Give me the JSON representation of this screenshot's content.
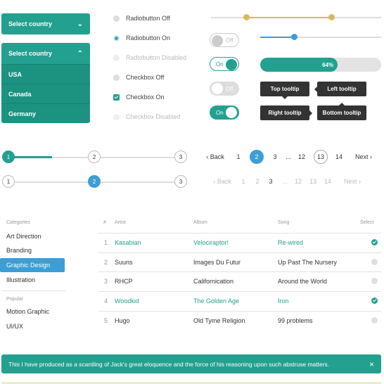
{
  "select_closed": {
    "label": "Select country"
  },
  "select_open": {
    "label": "Select country",
    "options": [
      "USA",
      "Canada",
      "Germany"
    ]
  },
  "options": {
    "radio_off": "Radiobutton Off",
    "radio_on": "Radiobutton On",
    "radio_disabled": "Radiobutton Disabled",
    "check_off": "Checkbox Off",
    "check_on": "Checkbox On",
    "check_disabled": "Checkbox Disabled"
  },
  "toggles": {
    "off_label": "Off",
    "on_label": "On"
  },
  "sliders": {
    "range_low": 0.21,
    "range_high": 0.71,
    "single": 0.28
  },
  "progress": {
    "value": 0.64,
    "label": "64%"
  },
  "tooltips": {
    "top": "Top tooltip",
    "left": "Left tooltip",
    "right": "Right tooltip",
    "bottom": "Bottom tooltip"
  },
  "steppers": [
    {
      "steps": [
        "1",
        "2",
        "3"
      ],
      "active": 0
    },
    {
      "steps": [
        "1",
        "2",
        "3"
      ],
      "active": 1
    }
  ],
  "pagination_active": {
    "back": "‹ Back",
    "next": "Next ›",
    "pages": [
      "1",
      "2",
      "3",
      "...",
      "12",
      "13",
      "14"
    ],
    "current": "2",
    "outlined": "13"
  },
  "pagination_disabled": {
    "back": "‹ Back",
    "next": "Next ›",
    "pages": [
      "1",
      "2",
      "3",
      "...",
      "12",
      "13",
      "14"
    ],
    "current": "3"
  },
  "sidebar": {
    "categories_header": "Categories",
    "categories": [
      "Art Direction",
      "Branding",
      "Graphic Design",
      "Illustration"
    ],
    "selected": "Graphic Design",
    "popular_header": "Popular",
    "popular": [
      "Motion Graphic",
      "UI/UX"
    ]
  },
  "table": {
    "headers": {
      "num": "#",
      "artist": "Artist",
      "album": "Album",
      "song": "Song",
      "select": "Select"
    },
    "rows": [
      {
        "num": "1",
        "artist": "Kasabian",
        "album": "Velociraptor!",
        "song": "Re-wired",
        "selected": true
      },
      {
        "num": "2",
        "artist": "Suuns",
        "album": "Images Du Futur",
        "song": "Up Past The Nursery",
        "selected": false
      },
      {
        "num": "3",
        "artist": "RHCP",
        "album": "Californication",
        "song": "Around the World",
        "selected": false
      },
      {
        "num": "4",
        "artist": "Woodkid",
        "album": "The Golden Age",
        "song": "Iron",
        "selected": true
      },
      {
        "num": "5",
        "artist": "Hugo",
        "album": "Old Tyme Religion",
        "song": "99 problems",
        "selected": false
      }
    ]
  },
  "alert": {
    "text": "This I have produced as a scantling of Jack's great eloquence and the force of his reasoning upon such abstruse matters.",
    "close": "×"
  },
  "colors": {
    "teal": "#23a08f",
    "blue": "#3c9ed4",
    "gold": "#d9b862",
    "dark": "#333333"
  }
}
